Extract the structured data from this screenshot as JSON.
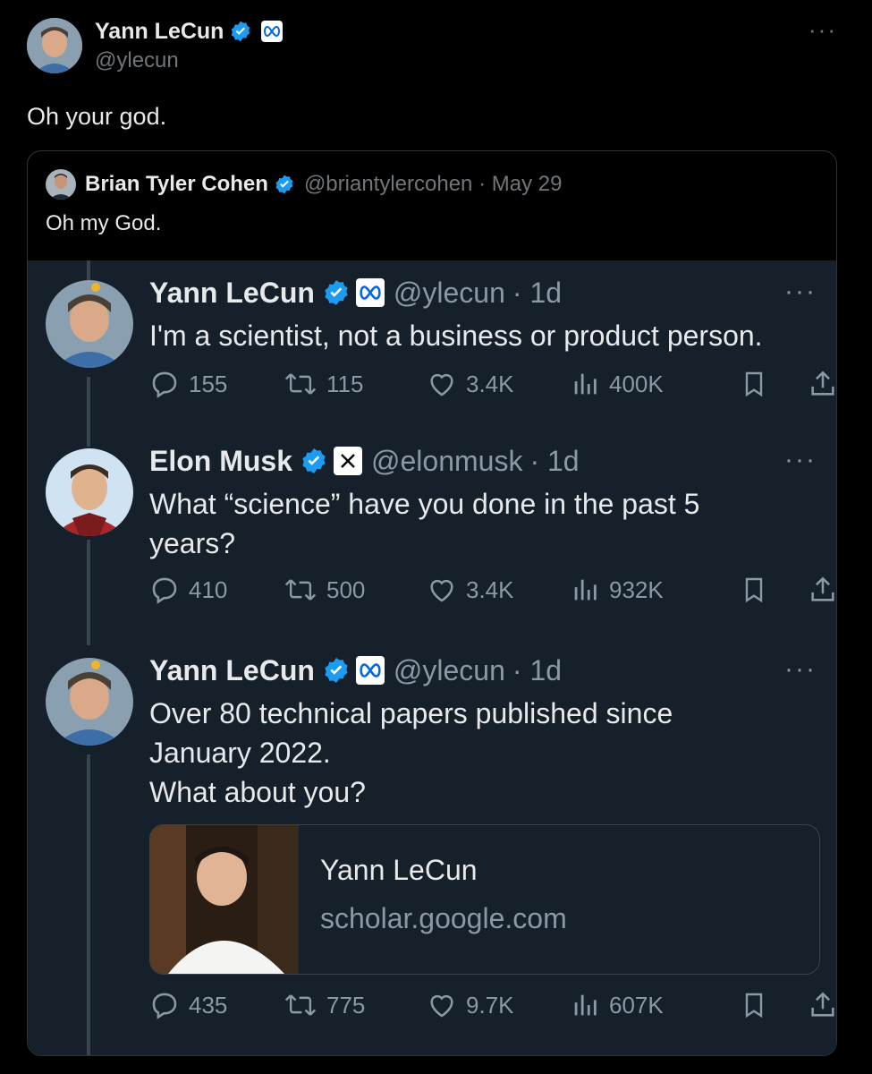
{
  "main_post": {
    "author_name": "Yann LeCun",
    "handle": "@ylecun",
    "text": "Oh your god.",
    "more": "···"
  },
  "quoted_post": {
    "author_name": "Brian Tyler Cohen",
    "handle_date": "@briantylercohen · May 29",
    "text": "Oh my God."
  },
  "thread": [
    {
      "author_name": "Yann LeCun",
      "handle": "@ylecun",
      "time": "· 1d",
      "text": "I'm a scientist, not a business or product person.",
      "replies": "155",
      "reposts": "115",
      "likes": "3.4K",
      "views": "400K",
      "more": "···"
    },
    {
      "author_name": "Elon Musk",
      "handle": "@elonmusk",
      "time": "· 1d",
      "text": "What “science” have you done in the past 5 years?",
      "replies": "410",
      "reposts": "500",
      "likes": "3.4K",
      "views": "932K",
      "more": "···"
    },
    {
      "author_name": "Yann LeCun",
      "handle": "@ylecun",
      "time": "· 1d",
      "text_lines": [
        "Over 80 technical papers published since",
        "January 2022.",
        "What about you?"
      ],
      "replies": "435",
      "reposts": "775",
      "likes": "9.7K",
      "views": "607K",
      "more": "···",
      "link_card": {
        "title": "Yann LeCun",
        "domain": "scholar.google.com"
      }
    }
  ],
  "colors": {
    "verified": "#1d9bf0",
    "bg": "#000000",
    "thread_bg": "#15202b",
    "muted": "#71767b"
  },
  "icons": [
    "verified-icon",
    "meta-logo-icon",
    "x-logo-icon",
    "reply-icon",
    "repost-icon",
    "like-icon",
    "views-icon",
    "bookmark-icon",
    "share-icon",
    "more-icon"
  ]
}
